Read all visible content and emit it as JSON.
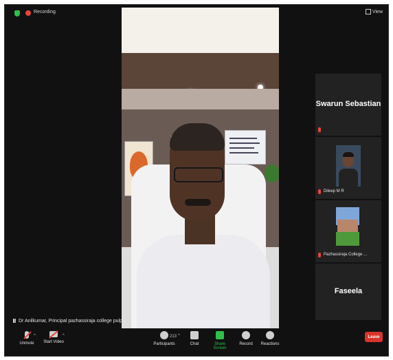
{
  "top_bar": {
    "recording_label": "Recording",
    "view_label": "View"
  },
  "participants": [
    {
      "name": "Swarun Sebastian",
      "display": "name-only"
    },
    {
      "name": "Dileep M R",
      "display": "video"
    },
    {
      "name": "Pazhassiraja College ...",
      "display": "image"
    },
    {
      "name": "Faseela",
      "display": "name-only"
    }
  ],
  "active_speaker": {
    "label": "Dr Anilkumar, Principal pazhassiraja college pulpa"
  },
  "toolbar": {
    "unmute": "Unmute",
    "start_video": "Start Video",
    "participants": "Participants",
    "participants_count": "213",
    "chat": "Chat",
    "share_screen": "Share Screen",
    "record": "Record",
    "reactions": "Reactions",
    "leave": "Leave"
  },
  "colors": {
    "background": "#111111",
    "tile": "#222222",
    "accent_green": "#2fbf4a",
    "leave_red": "#d9342b"
  }
}
